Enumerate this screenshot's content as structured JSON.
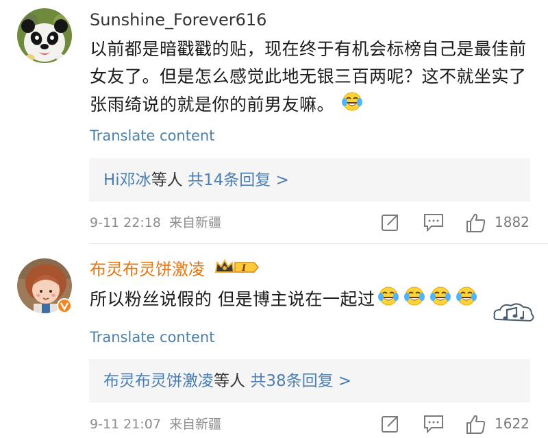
{
  "comments": [
    {
      "username": "Sunshine_Forever616",
      "text": "以前都是暗戳戳的贴，现在终于有机会标榜自己是最佳前女友了。但是怎么感觉此地无银三百两呢？这不就坐实了张雨绮说的就是你的前男友嘛。",
      "emoji": "laughing-tears-icon",
      "translate_label": "Translate content",
      "reply_names": "Hi邓冰",
      "reply_mid": "等人",
      "reply_count_label": "共14条回复 >",
      "date": "9-11 22:18",
      "source": "来自新疆",
      "likes": "1882",
      "avatar": "panda-avatar"
    },
    {
      "username": "布灵布灵饼激凌",
      "username_color": "#e8750f",
      "level_badge": "I",
      "text": "所以粉丝说假的 但是博主说在一起过",
      "emoji_count": 4,
      "emoji": "laughing-tears-icon",
      "sticker": "music-cloud-sticker",
      "translate_label": "Translate content",
      "reply_names": "布灵布灵饼激凌",
      "reply_mid": "等人",
      "reply_count_label": "共38条回复 >",
      "date": "9-11 21:07",
      "source": "来自新疆",
      "likes": "1622",
      "avatar": "cartoon-girl-avatar",
      "verified_badge": "verified-v-icon"
    }
  ],
  "colors": {
    "link_blue": "#4a7eb4",
    "translate_blue": "#4e7fa9",
    "meta_gray": "#8c8c8c",
    "reply_bg": "#f5f5f5",
    "vip_orange": "#e8750f"
  }
}
